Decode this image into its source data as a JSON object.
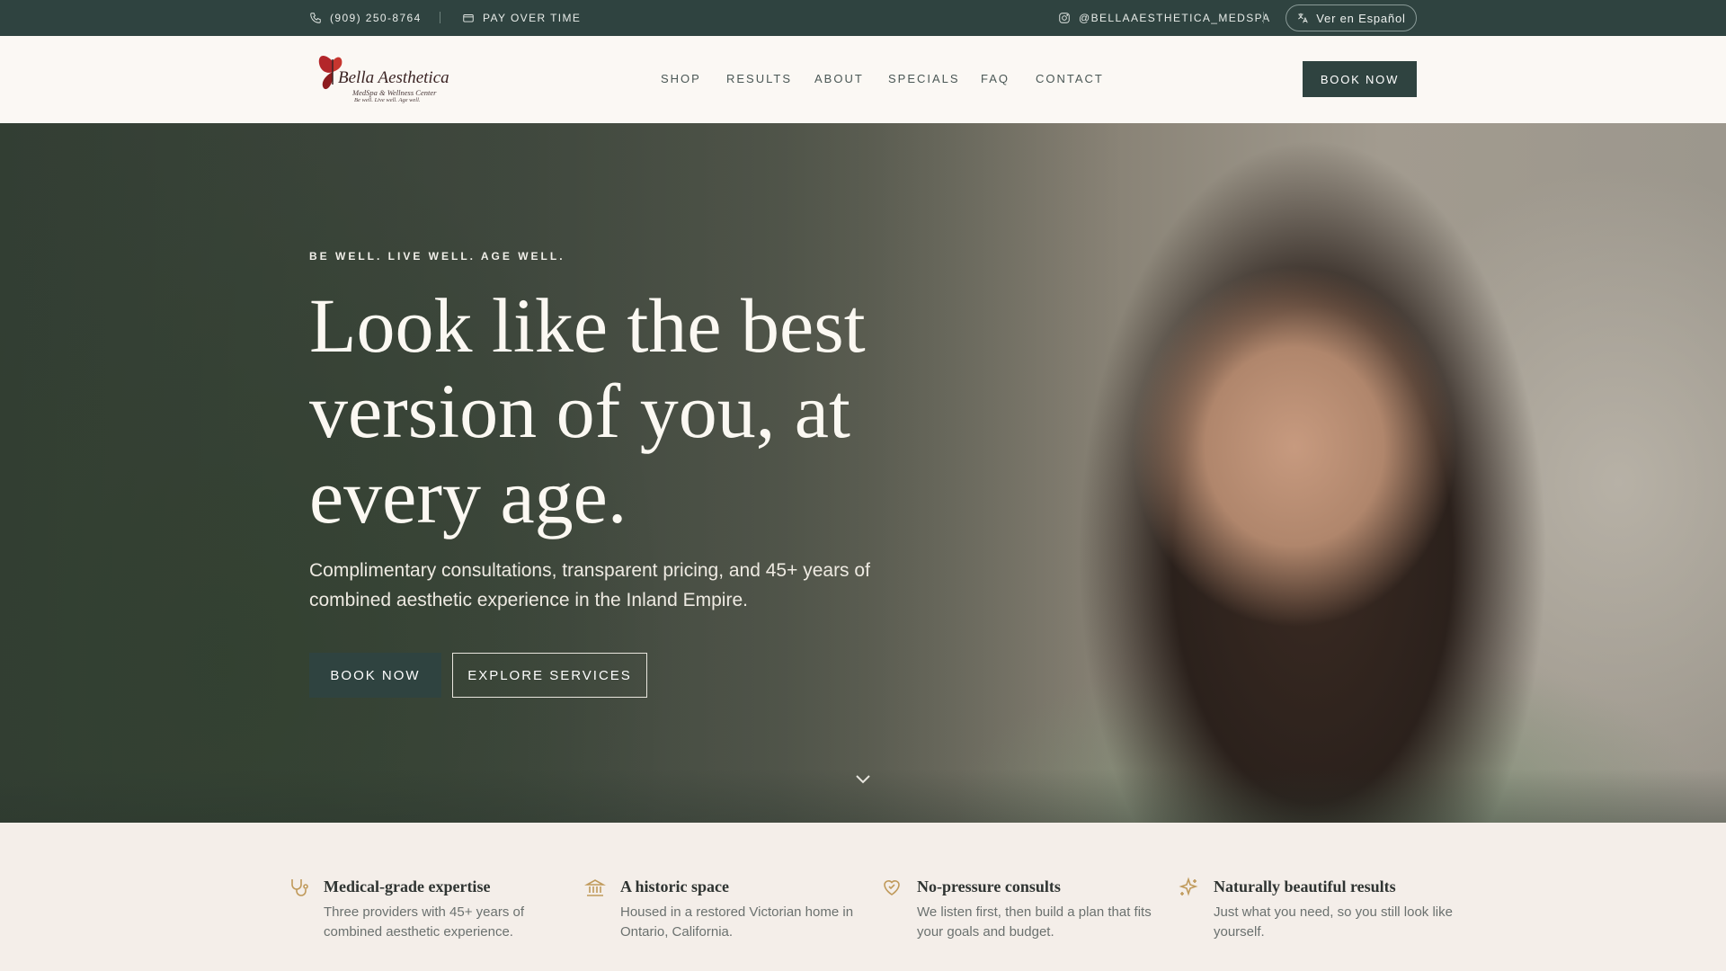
{
  "topbar": {
    "phone": "(909) 250-8764",
    "pay": "PAY OVER TIME",
    "instagram": "@BELLAAESTHETICA_MEDSPA",
    "language_button": "Ver en Español"
  },
  "nav": {
    "logo_name": "Bella Aesthetica",
    "logo_sub": "MedSpa & Wellness Center",
    "logo_tagline": "Be well. Live well. Age well.",
    "items": [
      "SHOP",
      "RESULTS",
      "ABOUT",
      "SPECIALS",
      "FAQ",
      "CONTACT"
    ],
    "book_label": "BOOK NOW"
  },
  "hero": {
    "eyebrow": "BE WELL. LIVE WELL. AGE WELL.",
    "headline": "Look like the best version of you, at every age.",
    "subcopy": "Complimentary consultations, transparent pricing, and 45+ years of combined aesthetic experience in the Inland Empire.",
    "book_label": "BOOK NOW",
    "explore_label": "EXPLORE SERVICES"
  },
  "features": [
    {
      "icon": "stethoscope-icon",
      "title": "Medical-grade expertise",
      "text": "Three providers with 45+ years of combined aesthetic experience."
    },
    {
      "icon": "building-columns-icon",
      "title": "A historic space",
      "text": "Housed in a restored Victorian home in Ontario, California."
    },
    {
      "icon": "heart-handshake-icon",
      "title": "No-pressure consults",
      "text": "We listen first, then build a plan that fits your goals and budget."
    },
    {
      "icon": "sparkle-icon",
      "title": "Naturally beautiful results",
      "text": "Just what you need, so you still look like yourself."
    }
  ],
  "colors": {
    "primary": "#2f4340",
    "accent_gold": "#c09a5b",
    "background": "#f4eee9",
    "nav_background": "#fbf8f4"
  }
}
